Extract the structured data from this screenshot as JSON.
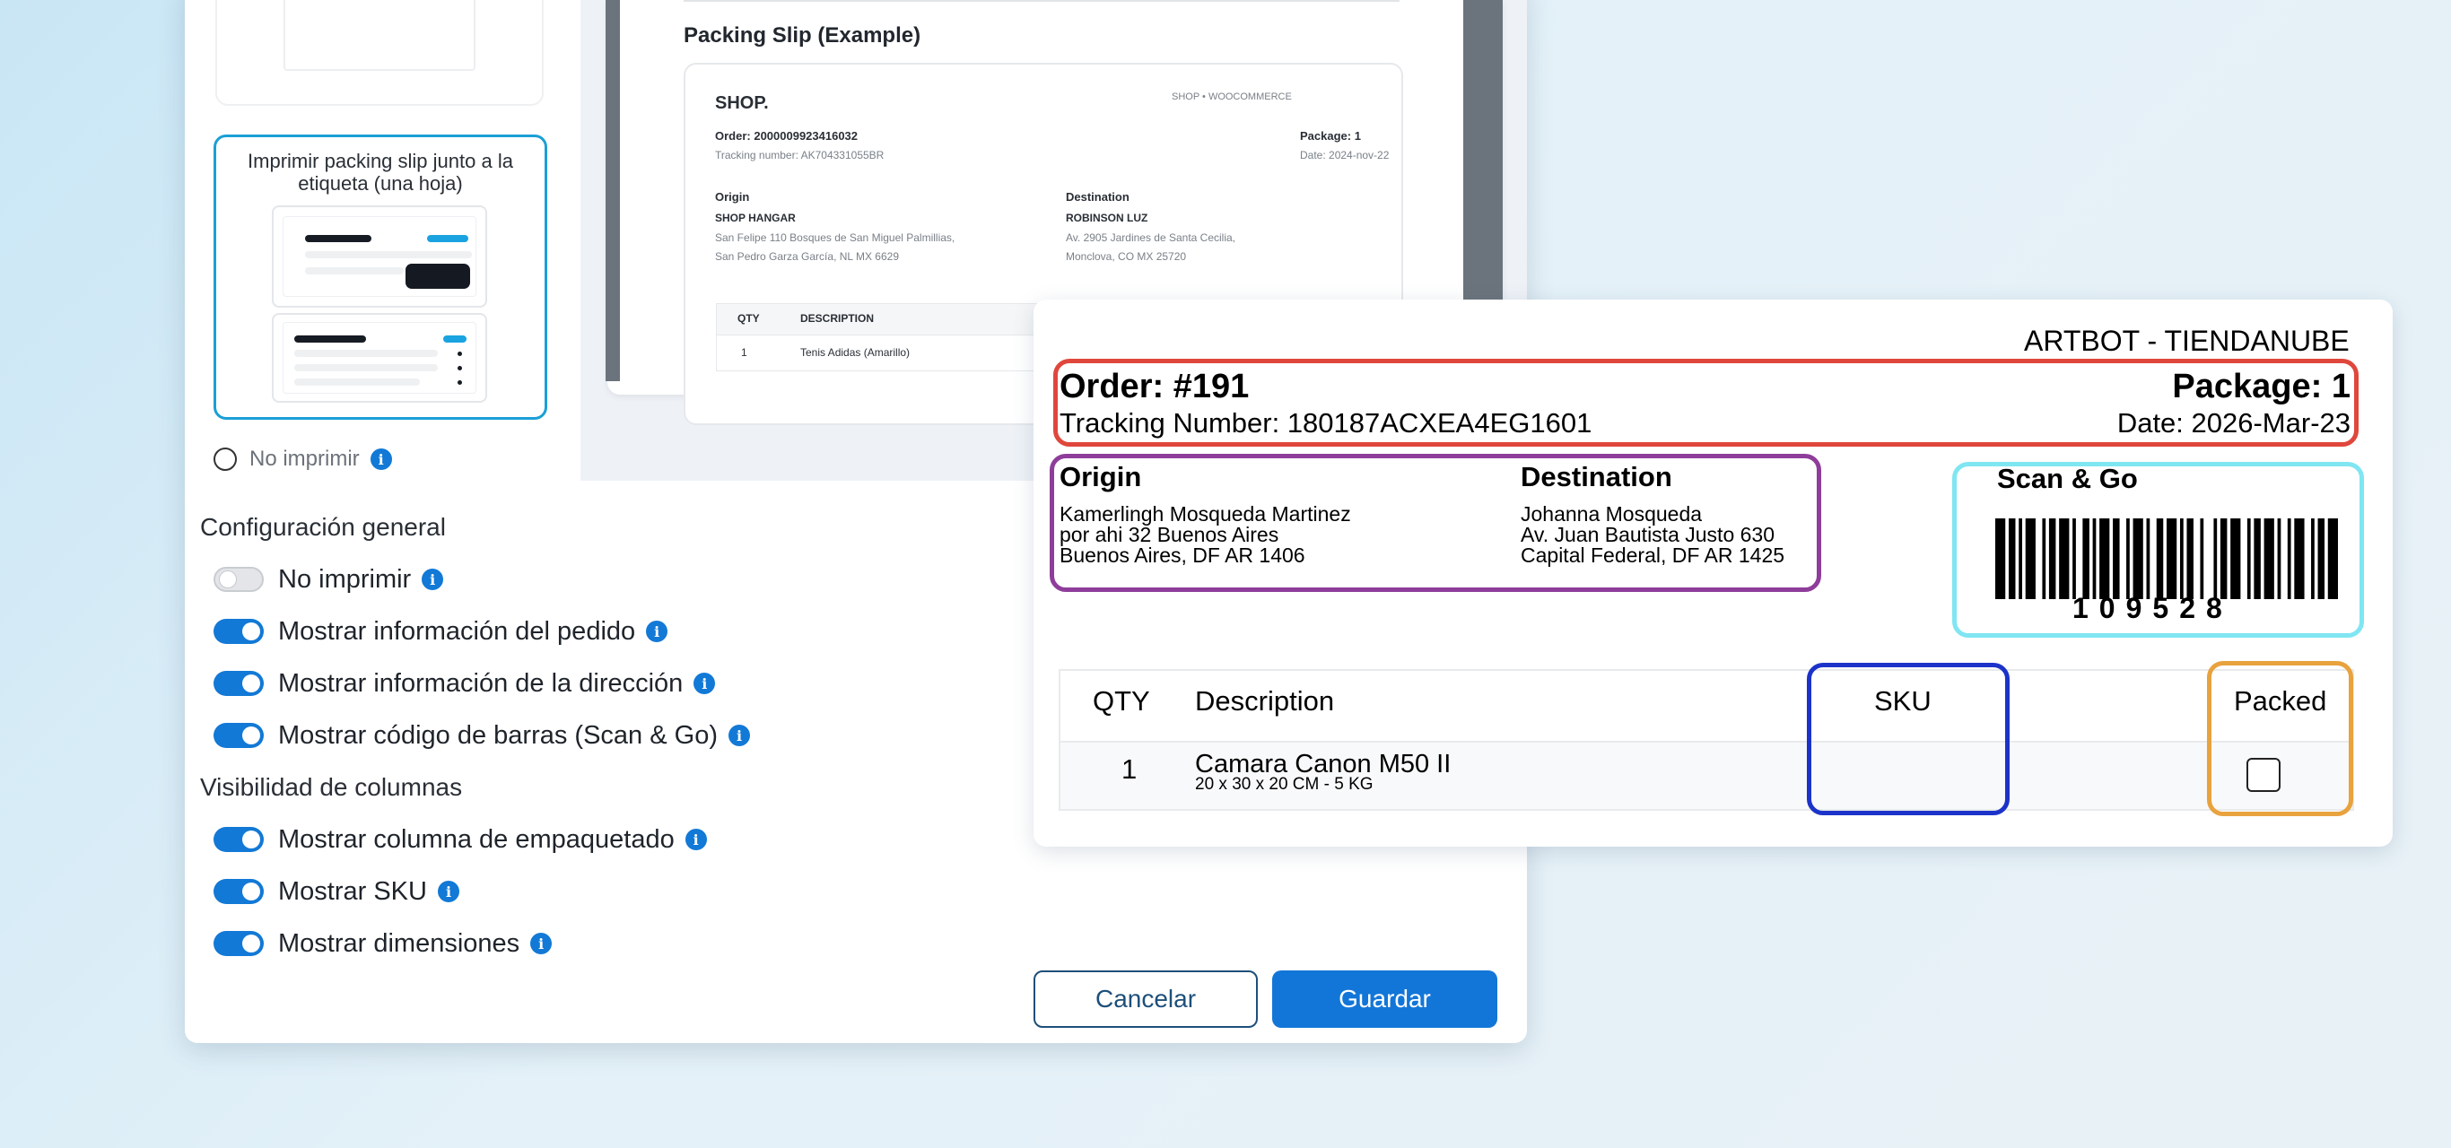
{
  "print_options": {
    "selected_title": "Imprimir packing slip junto a la etiqueta (una hoja)",
    "no_print": "No imprimir"
  },
  "general": {
    "title": "Configuración general",
    "toggles": [
      {
        "label": "No imprimir",
        "on": false
      },
      {
        "label": "Mostrar información del pedido",
        "on": true
      },
      {
        "label": "Mostrar información de la dirección",
        "on": true
      },
      {
        "label": "Mostrar código de barras (Scan & Go)",
        "on": true
      }
    ]
  },
  "columns": {
    "title": "Visibilidad de columnas",
    "toggles": [
      {
        "label": "Mostrar columna de empaquetado",
        "on": true
      },
      {
        "label": "Mostrar SKU",
        "on": true
      },
      {
        "label": "Mostrar dimensiones",
        "on": true
      }
    ]
  },
  "buttons": {
    "cancel": "Cancelar",
    "save": "Guardar"
  },
  "slip": {
    "title": "Packing Slip (Example)",
    "shop": "SHOP.",
    "shop_tag": "SHOP • WOOCOMMERCE",
    "order": "Order: 2000009923416032",
    "tracking": "Tracking number: AK704331055BR",
    "package": "Package: 1",
    "date": "Date: 2024-nov-22",
    "origin_label": "Origin",
    "origin_name": "SHOP HANGAR",
    "origin_l1": "San Felipe 110 Bosques de San Miguel Palmillias,",
    "origin_l2": "San Pedro Garza García, NL MX 6629",
    "dest_label": "Destination",
    "dest_name": "ROBINSON LUZ",
    "dest_l1": "Av. 2905 Jardines de Santa Cecilia,",
    "dest_l2": "Monclova, CO MX 25720",
    "col_qty": "QTY",
    "col_desc": "DESCRIPTION",
    "row_qty": "1",
    "row_desc": "Tenis Adidas (Amarillo)"
  },
  "label": {
    "store": "ARTBOT - TIENDANUBE",
    "order": "Order: #191",
    "package": "Package: 1",
    "tracking": "Tracking Number: 180187ACXEA4EG1601",
    "date": "Date: 2026-Mar-23",
    "origin_label": "Origin",
    "origin_l1": "Kamerlingh Mosqueda Martinez",
    "origin_l2": "por ahi 32 Buenos Aires",
    "origin_l3": "Buenos Aires, DF AR 1406",
    "dest_label": "Destination",
    "dest_l1": "Johanna Mosqueda",
    "dest_l2": "Av. Juan Bautista Justo 630",
    "dest_l3": "Capital Federal, DF AR 1425",
    "scan_title": "Scan & Go",
    "barcode_number": "109528",
    "col_qty": "QTY",
    "col_desc": "Description",
    "col_sku": "SKU",
    "col_packed": "Packed",
    "row_qty": "1",
    "row_desc": "Camara Canon M50 II",
    "row_dims": "20 x 30 x 20 CM - 5 KG"
  },
  "colors": {
    "accent": "#1276d8",
    "header_box": "#e0473c",
    "address_box": "#8f3d9b",
    "scan_box": "#7fe6f2",
    "sku_box": "#1c33c9",
    "packed_box": "#e8a23e"
  }
}
